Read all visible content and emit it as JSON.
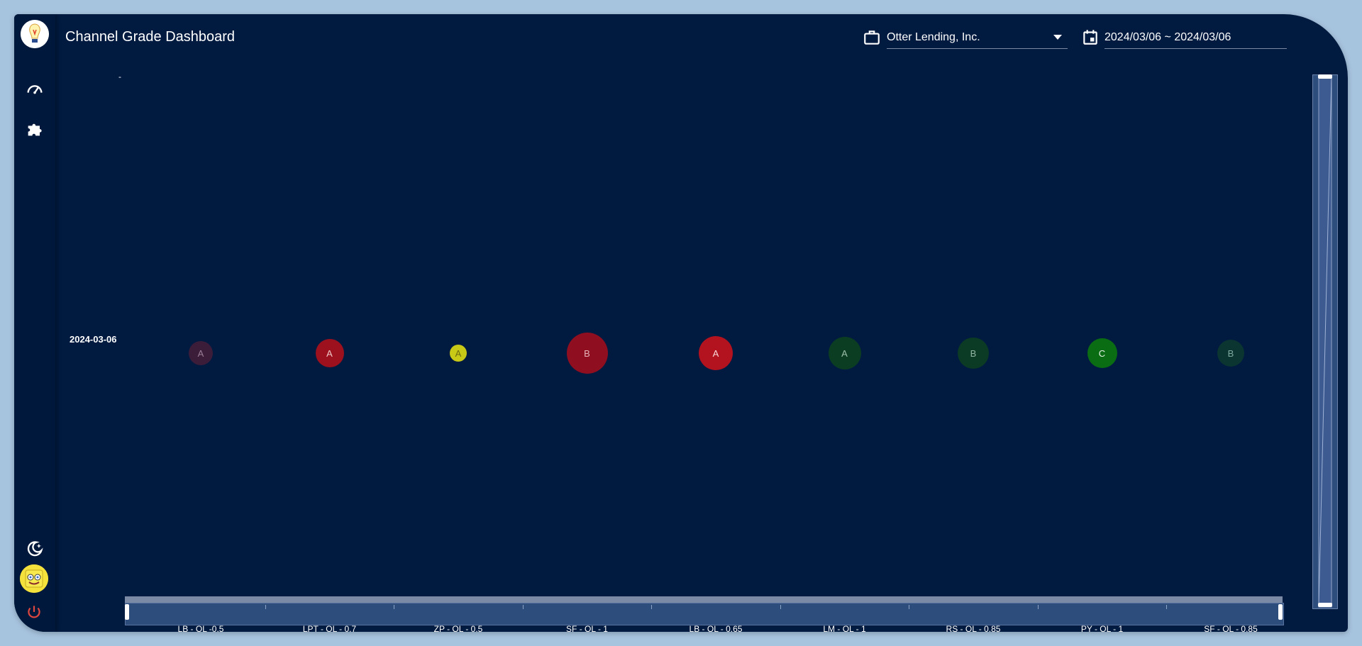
{
  "app": {
    "title": "Channel Grade Dashboard"
  },
  "header": {
    "company": {
      "icon": "briefcase-icon",
      "value": "Otter Lending, Inc."
    },
    "date_range": {
      "icon": "calendar-icon",
      "value": "2024/03/06 ~ 2024/03/06"
    }
  },
  "sidebar": {
    "items": [
      {
        "icon": "speedometer-icon"
      },
      {
        "icon": "puzzle-icon"
      },
      {
        "icon": "dark-mode-icon"
      },
      {
        "icon": "power-icon"
      }
    ]
  },
  "chart_data": {
    "type": "scatter",
    "y_top_tick": "-",
    "rows": [
      "2024-03-06"
    ],
    "categories": [
      "LB - OL -0.5",
      "LPT - OL - 0.7",
      "ZP - OL - 0.5",
      "SF - OL - 1",
      "LB - OL - 0.65",
      "LM - OL - 1",
      "RS - OL - 0.85",
      "PY - OL - 1",
      "SF - OL - 0.85"
    ],
    "points": [
      {
        "category": "LB - OL -0.5",
        "row": "2024-03-06",
        "grade": "A",
        "color": "#3b1d3a",
        "text_color": "#9a7e96",
        "size": 34
      },
      {
        "category": "LPT - OL - 0.7",
        "row": "2024-03-06",
        "grade": "A",
        "color": "#9c111d",
        "text_color": "#f0c8c8",
        "size": 40
      },
      {
        "category": "ZP - OL - 0.5",
        "row": "2024-03-06",
        "grade": "A",
        "color": "#c8c817",
        "text_color": "#6b6b10",
        "size": 24
      },
      {
        "category": "SF - OL - 1",
        "row": "2024-03-06",
        "grade": "B",
        "color": "#8f0f20",
        "text_color": "#e6b0b6",
        "size": 58
      },
      {
        "category": "LB - OL - 0.65",
        "row": "2024-03-06",
        "grade": "A",
        "color": "#b3121f",
        "text_color": "#f8dada",
        "size": 48
      },
      {
        "category": "LM - OL - 1",
        "row": "2024-03-06",
        "grade": "A",
        "color": "#0b3d22",
        "text_color": "#9cc0a8",
        "size": 46
      },
      {
        "category": "RS - OL - 0.85",
        "row": "2024-03-06",
        "grade": "B",
        "color": "#0b3a25",
        "text_color": "#91b6a0",
        "size": 44
      },
      {
        "category": "PY - OL - 1",
        "row": "2024-03-06",
        "grade": "C",
        "color": "#0b6d13",
        "text_color": "#e2f2e2",
        "size": 42
      },
      {
        "category": "SF - OL - 0.85",
        "row": "2024-03-06",
        "grade": "B",
        "color": "#0b3530",
        "text_color": "#7ea9a0",
        "size": 38
      }
    ]
  }
}
